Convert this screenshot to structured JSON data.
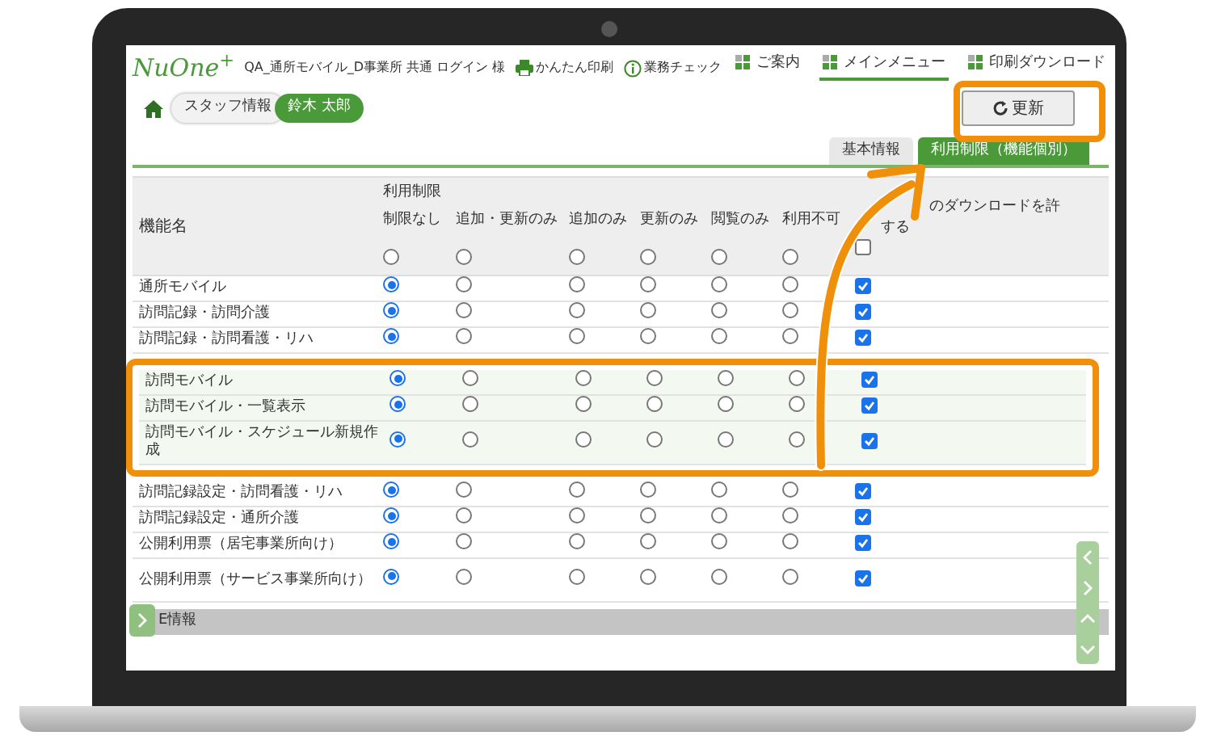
{
  "header": {
    "logo": "NuOne$^{+}$",
    "user": "QA_通所モバイル_D事業所 共通 ログイン 様",
    "links": [
      {
        "kind": "print",
        "label": "かんたん印刷"
      },
      {
        "kind": "info",
        "label": "業務チェック"
      }
    ],
    "nav": [
      {
        "label": "ご案内",
        "selected": false
      },
      {
        "label": "メインメニュー",
        "selected": true
      },
      {
        "label": "印刷ダウンロード",
        "selected": false
      }
    ]
  },
  "breadcrumb": [
    {
      "label": "スタッフ情報",
      "selected": false
    },
    {
      "label": "鈴木 太郎",
      "selected": true
    }
  ],
  "refresh_button": "更新",
  "tabs": [
    {
      "label": "基本情報",
      "selected": false
    },
    {
      "label": "利用制限（機能個別）",
      "selected": true
    }
  ],
  "table": {
    "name_heading": "機能名",
    "group_heading": "利用制限",
    "columns": [
      "制限なし",
      "追加・更新のみ",
      "追加のみ",
      "更新のみ",
      "閲覧のみ",
      "利用不可"
    ],
    "download_heading": [
      "のダウンロードを許",
      "する"
    ],
    "header_options": [
      false,
      false,
      false,
      false,
      false,
      false
    ],
    "header_checked": false,
    "rows": [
      {
        "name": "通所モバイル",
        "options": [
          true,
          false,
          false,
          false,
          false,
          false
        ],
        "checked": true,
        "highlighted": false
      },
      {
        "name": "訪問記録・訪問介護",
        "options": [
          true,
          false,
          false,
          false,
          false,
          false
        ],
        "checked": true,
        "highlighted": false
      },
      {
        "name": "訪問記録・訪問看護・リハ",
        "options": [
          true,
          false,
          false,
          false,
          false,
          false
        ],
        "checked": true,
        "highlighted": false
      },
      {
        "name": "訪問モバイル",
        "options": [
          true,
          false,
          false,
          false,
          false,
          false
        ],
        "checked": true,
        "highlighted": true
      },
      {
        "name": "訪問モバイル・一覧表示",
        "options": [
          true,
          false,
          false,
          false,
          false,
          false
        ],
        "checked": true,
        "highlighted": true
      },
      {
        "name": "訪問モバイル・スケジュール新規作成",
        "options": [
          true,
          false,
          false,
          false,
          false,
          false
        ],
        "checked": true,
        "highlighted": true
      },
      {
        "name": "訪問記録設定・訪問看護・リハ",
        "options": [
          true,
          false,
          false,
          false,
          false,
          false
        ],
        "checked": true,
        "highlighted": false
      },
      {
        "name": "訪問記録設定・通所介護",
        "options": [
          true,
          false,
          false,
          false,
          false,
          false
        ],
        "checked": true,
        "highlighted": false
      },
      {
        "name": "公開利用票（居宅事業所向け）",
        "options": [
          true,
          false,
          false,
          false,
          false,
          false
        ],
        "checked": true,
        "highlighted": false
      },
      {
        "name": "公開利用票（サービス事業所向け）",
        "options": [
          true,
          false,
          false,
          false,
          false,
          false
        ],
        "checked": true,
        "highlighted": false
      }
    ]
  },
  "footer_section": "E情報",
  "side_buttons": [
    {
      "kind": "left"
    },
    {
      "kind": "right"
    },
    {
      "kind": "up"
    },
    {
      "kind": "down"
    }
  ]
}
